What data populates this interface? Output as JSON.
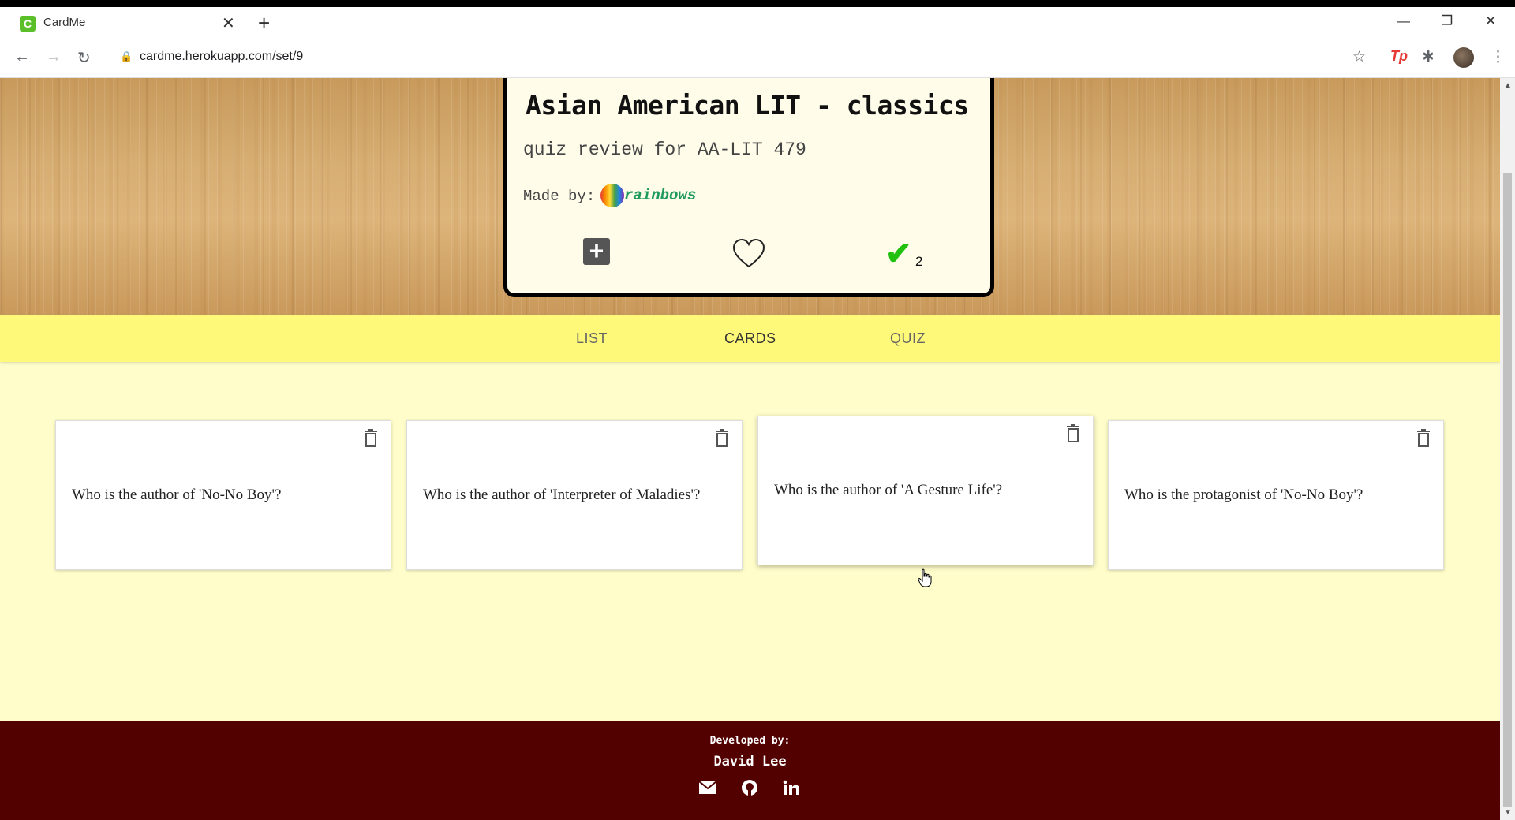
{
  "browser": {
    "tab_title": "CardMe",
    "favicon_letter": "C",
    "url": "cardme.herokuapp.com/set/9"
  },
  "set": {
    "title": "Asian American LIT - classics",
    "description": "quiz review for AA-LIT 479",
    "made_by_label": "Made by:",
    "author": "rainbows",
    "completions": "2"
  },
  "tabs": [
    "LIST",
    "CARDS",
    "QUIZ"
  ],
  "active_tab": "CARDS",
  "cards": [
    {
      "question": "Who is the author of 'No-No Boy'?"
    },
    {
      "question": "Who is the author of 'Interpreter of Maladies'?"
    },
    {
      "question": "Who is the author of 'A Gesture Life'?"
    },
    {
      "question": "Who is the protagonist of 'No-No Boy'?"
    }
  ],
  "footer": {
    "developed_by_label": "Developed by:",
    "developer": "David Lee"
  },
  "icons": {
    "add": "plus-square-icon",
    "favorite": "heart-outline-icon",
    "complete": "checkmark-icon",
    "delete": "trash-icon",
    "email": "envelope-icon",
    "github": "github-icon",
    "linkedin": "linkedin-icon"
  },
  "colors": {
    "page_bg": "#fffdc9",
    "tabs_bg": "#fff97a",
    "footer_bg": "#530000",
    "author_link": "#1e9a5e",
    "check": "#22c10f"
  }
}
